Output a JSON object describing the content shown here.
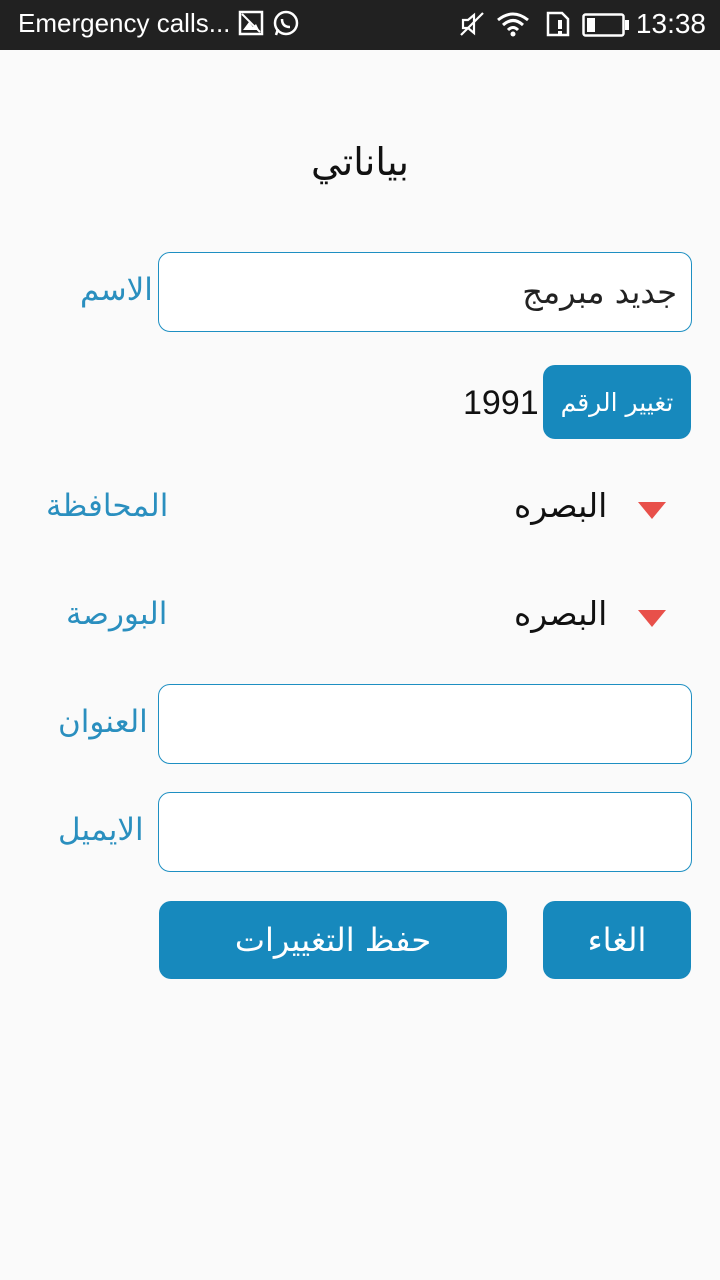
{
  "status_bar": {
    "notification_text": "Emergency calls...",
    "time": "13:38"
  },
  "page": {
    "title": "بياناتي"
  },
  "form": {
    "name_label": "الاسم",
    "name_value": "جديد مبرمج",
    "number_value": "1991",
    "change_number_button": "تغيير الرقم",
    "governorate_label": "المحافظة",
    "governorate_value": "البصره",
    "exchange_label": "البورصة",
    "exchange_value": "البصره",
    "address_label": "العنوان",
    "address_value": "",
    "email_label": "الايميل",
    "email_value": ""
  },
  "actions": {
    "save_label": "حفظ التغييرات",
    "cancel_label": "الغاء"
  },
  "colors": {
    "accent": "#1789bd",
    "label": "#2a8fbf",
    "dropdown_arrow": "#e8504a",
    "status_bar": "#212121"
  }
}
